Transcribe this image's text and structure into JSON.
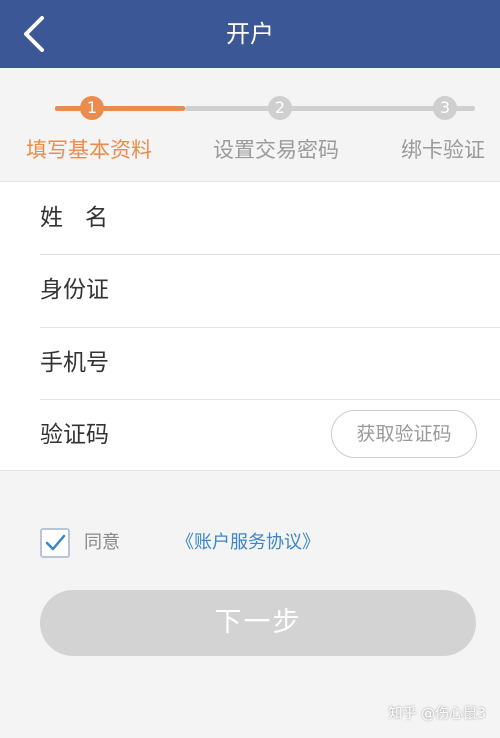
{
  "header": {
    "title": "开户",
    "background": "#3b5796"
  },
  "steps": [
    {
      "number": "1",
      "label": "填写基本资料",
      "active": true
    },
    {
      "number": "2",
      "label": "设置交易密码",
      "active": false
    },
    {
      "number": "3",
      "label": "绑卡验证",
      "active": false
    }
  ],
  "step_colors": {
    "active": "#eb8c4e",
    "inactive": "#cfcfcf"
  },
  "form": {
    "name_label": "姓名",
    "id_label": "身份证",
    "phone_label": "手机号",
    "code_label": "验证码",
    "get_code_button": "获取验证码"
  },
  "agreement": {
    "checked": true,
    "text": "同意",
    "link": "《账户服务协议》",
    "link_color": "#3a86c8"
  },
  "next_button": "下一步",
  "watermark": "知乎 @伤心鼠3"
}
